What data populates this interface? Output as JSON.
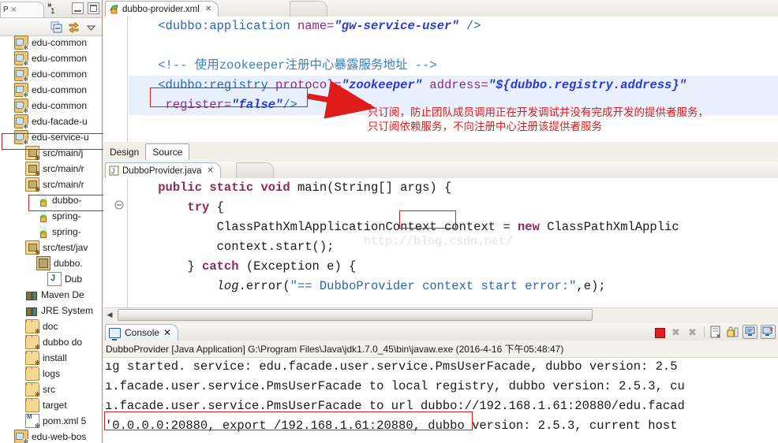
{
  "explorer": {
    "tab_label": "P",
    "tab_close": "✕",
    "chevron": "»",
    "chevron_count": "1",
    "toolbar": [
      {
        "name": "collapse-all-icon",
        "glyph": "⊟"
      },
      {
        "name": "link-with-editor-icon",
        "glyph": "⇄"
      },
      {
        "name": "view-menu-icon",
        "glyph": "▽"
      }
    ],
    "minimize_label": "Minimize",
    "maximize_label": "Maximize",
    "tree": [
      {
        "label": "edu-common",
        "icon": "project-icon",
        "indent": 1,
        "highlight": false
      },
      {
        "label": "edu-common",
        "icon": "project-icon",
        "indent": 1,
        "highlight": false
      },
      {
        "label": "edu-common",
        "icon": "project-icon",
        "indent": 1,
        "highlight": false
      },
      {
        "label": "edu-common",
        "icon": "project-icon",
        "indent": 1,
        "highlight": false
      },
      {
        "label": "edu-common",
        "icon": "project-icon",
        "indent": 1,
        "highlight": false
      },
      {
        "label": "edu-facade-u",
        "icon": "project-icon",
        "indent": 1,
        "highlight": false
      },
      {
        "label": "edu-service-u",
        "icon": "project-icon",
        "indent": 1,
        "highlight": true
      },
      {
        "label": "src/main/j",
        "icon": "source-folder-icon",
        "indent": 2,
        "highlight": false
      },
      {
        "label": "src/main/r",
        "icon": "source-folder-icon",
        "indent": 2,
        "highlight": false
      },
      {
        "label": "src/main/r",
        "icon": "source-folder-icon",
        "indent": 2,
        "highlight": false
      },
      {
        "label": "dubbo-",
        "icon": "xml-file-icon",
        "indent": 3,
        "highlight": true
      },
      {
        "label": "spring-",
        "icon": "xml-file-icon",
        "indent": 3,
        "highlight": false
      },
      {
        "label": "spring-",
        "icon": "xml-file-icon",
        "indent": 3,
        "highlight": false
      },
      {
        "label": "src/test/jav",
        "icon": "source-folder-icon",
        "indent": 2,
        "highlight": false
      },
      {
        "label": "dubbo.",
        "icon": "package-icon",
        "indent": 3,
        "highlight": false
      },
      {
        "label": "Dub",
        "icon": "java-file-icon",
        "indent": 4,
        "highlight": false
      },
      {
        "label": "Maven De",
        "icon": "library-icon",
        "indent": 2,
        "highlight": false
      },
      {
        "label": "JRE System",
        "icon": "library-icon",
        "indent": 2,
        "highlight": false
      },
      {
        "label": "doc",
        "icon": "folder-icon",
        "indent": 2,
        "highlight": false
      },
      {
        "label": "dubbo do",
        "icon": "folder-icon",
        "indent": 2,
        "highlight": false
      },
      {
        "label": "install",
        "icon": "folder-icon",
        "indent": 2,
        "highlight": false
      },
      {
        "label": "logs",
        "icon": "folder-plain-icon",
        "indent": 2,
        "highlight": false
      },
      {
        "label": "src",
        "icon": "folder-special-icon",
        "indent": 2,
        "highlight": false
      },
      {
        "label": "target",
        "icon": "folder-plain-icon",
        "indent": 2,
        "highlight": false
      },
      {
        "label": "pom.xml 5",
        "icon": "pom-file-icon",
        "indent": 2,
        "highlight": false
      },
      {
        "label": "edu-web-bos",
        "icon": "project-icon",
        "indent": 1,
        "highlight": false
      }
    ]
  },
  "xml_editor": {
    "tab_title": "dubbo-provider.xml",
    "tab_close": "✕",
    "lines": [
      {
        "segments": [
          {
            "t": "    ",
            "c": "t-plain"
          },
          {
            "t": "<dubbo:application",
            "c": "t-tag"
          },
          {
            "t": " name=",
            "c": "t-attr"
          },
          {
            "t": "\"gw-service-user\"",
            "c": "t-val"
          },
          {
            "t": " />",
            "c": "t-sym"
          }
        ]
      },
      {
        "segments": []
      },
      {
        "segments": [
          {
            "t": "    ",
            "c": "t-plain"
          },
          {
            "t": "<!-- ",
            "c": "t-cmt"
          },
          {
            "t": "使用zookeeper注册中心暴露服务地址",
            "c": "t-cmt"
          },
          {
            "t": " -->",
            "c": "t-cmt"
          }
        ]
      },
      {
        "segments": [
          {
            "t": "    ",
            "c": "t-plain"
          },
          {
            "t": "<dubbo:registry",
            "c": "t-tag"
          },
          {
            "t": " protocol=",
            "c": "t-attr"
          },
          {
            "t": "\"zookeeper\"",
            "c": "t-val"
          },
          {
            "t": " address=",
            "c": "t-attr"
          },
          {
            "t": "\"${dubbo.registry.address}\"",
            "c": "t-val"
          }
        ]
      },
      {
        "segments": [
          {
            "t": "     ",
            "c": "t-plain"
          },
          {
            "t": "register",
            "c": "t-attr"
          },
          {
            "t": "=",
            "c": "t-attr"
          },
          {
            "t": "\"false\"",
            "c": "t-val"
          },
          {
            "t": "/>",
            "c": "t-sym"
          }
        ]
      }
    ],
    "annotation_line1": "只订阅，防止团队成员调用正在开发调试并没有完成开发的提供者服务，",
    "annotation_line2": "只订阅依赖服务，不向注册中心注册该提供者服务",
    "design_tab": "Design",
    "source_tab": "Source",
    "scroll_left_arrow": "◀"
  },
  "java_editor": {
    "tab_title": "DubboProvider.java",
    "tab_close": "✕",
    "watermark": "http://blog.csdn.net/",
    "lines": [
      {
        "segments": [
          {
            "t": "    ",
            "c": "j-txt"
          },
          {
            "t": "public static void ",
            "c": "j-kw"
          },
          {
            "t": "main",
            "c": "j-txt"
          },
          {
            "t": "(String[] args) {",
            "c": "j-txt"
          }
        ]
      },
      {
        "segments": [
          {
            "t": "        ",
            "c": "j-txt"
          },
          {
            "t": "try",
            "c": "j-kw"
          },
          {
            "t": " {",
            "c": "j-txt"
          }
        ]
      },
      {
        "segments": [
          {
            "t": "            ClassPathXmlApplicationContext context = ",
            "c": "j-txt"
          },
          {
            "t": "new",
            "c": "j-kw"
          },
          {
            "t": " ClassPathXmlApplic",
            "c": "j-txt"
          }
        ]
      },
      {
        "segments": [
          {
            "t": "            context.start();",
            "c": "j-txt"
          }
        ]
      },
      {
        "segments": [
          {
            "t": "        } ",
            "c": "j-txt"
          },
          {
            "t": "catch",
            "c": "j-kw"
          },
          {
            "t": " (Exception e) {",
            "c": "j-txt"
          }
        ]
      },
      {
        "segments": [
          {
            "t": "            ",
            "c": "j-txt"
          },
          {
            "t": "log",
            "c": "j-fld"
          },
          {
            "t": ".error(",
            "c": "j-txt"
          },
          {
            "t": "\"== DubboProvider context start error:\"",
            "c": "j-str"
          },
          {
            "t": ",e);",
            "c": "j-txt"
          }
        ]
      }
    ],
    "scroll_left_arrow": "◀"
  },
  "console": {
    "tab_title": "Console",
    "tab_close": "✕",
    "launch_header": "DubboProvider [Java Application] G:\\Program Files\\Java\\jdk1.7.0_45\\bin\\javaw.exe (2016-4-16 下午05:48:47)",
    "toolbar": [
      {
        "name": "terminate-icon",
        "label": "Terminate"
      },
      {
        "name": "remove-launch-icon",
        "label": "Remove Launch"
      },
      {
        "name": "remove-all-terminated-icon",
        "label": "Remove All Terminated Launches"
      },
      {
        "name": "clear-console-icon",
        "label": "Clear Console"
      },
      {
        "name": "scroll-lock-icon",
        "label": "Scroll Lock"
      },
      {
        "name": "display-selected-console-icon",
        "label": "Display Selected Console"
      },
      {
        "name": "open-console-icon",
        "label": "Open Console"
      }
    ],
    "output_lines": [
      "ıg started. service: edu.facade.user.service.PmsUserFacade, dubbo version: 2.5",
      "ı.facade.user.service.PmsUserFacade to local registry, dubbo version: 2.5.3, cu",
      "ı.facade.user.service.PmsUserFacade to url dubbo://192.168.1.61:20880/edu.facad",
      "'0.0.0.0:20880, export /192.168.1.61:20880, dubbo version: 2.5.3, current host"
    ]
  },
  "colors": {
    "annotation_red": "#e01b1b",
    "xml_tag_blue": "#2b68b0",
    "xml_attr_purple": "#8d2a8d",
    "xml_value_blue": "#2a3ad8",
    "java_keyword": "#8d2a5a",
    "highlight_line": "#e8f0fb"
  }
}
